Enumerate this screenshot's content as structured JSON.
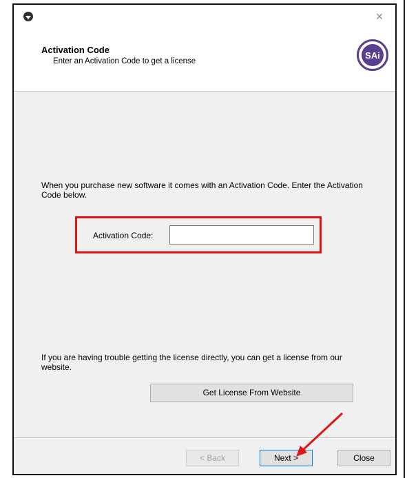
{
  "window": {
    "close_glyph": "×"
  },
  "header": {
    "title": "Activation Code",
    "subtitle": "Enter an Activation Code to get a license",
    "logo_text": "SAi",
    "logo_color": "#5a3f8e"
  },
  "main": {
    "intro_text": "When you purchase new software it comes with an Activation Code.  Enter the Activation Code below.",
    "activation_label": "Activation Code:",
    "activation_value": "",
    "trouble_text": "If you are having trouble getting the license directly, you can get a license from our website.",
    "website_button": "Get License From Website"
  },
  "footer": {
    "back_label": "< Back",
    "next_label": "Next >",
    "close_label": "Close"
  },
  "annotations": {
    "highlight_color": "#e01515"
  }
}
